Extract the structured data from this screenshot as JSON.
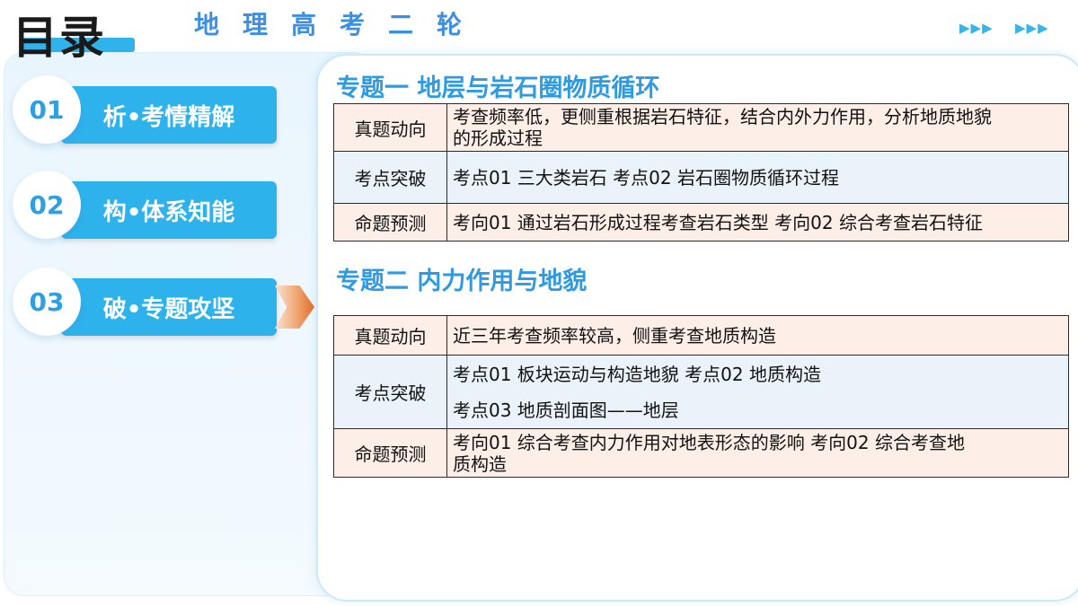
{
  "header": {
    "title": "目录",
    "subject": "地理高考二轮",
    "arrows_left": "▶▶▶",
    "arrows_right": "▶▶▶"
  },
  "menu": [
    {
      "number": "01",
      "label": "析•考情精解"
    },
    {
      "number": "02",
      "label": "构•体系知能"
    },
    {
      "number": "03",
      "label": "破•专题攻坚"
    }
  ],
  "topics": [
    {
      "title": "专题一  地层与岩石圈物质循环",
      "rows": [
        {
          "head": "真题动向",
          "lines": [
            "考查频率低，更侧重根据岩石特征，结合内外力作用，分析地质地貌",
            "的形成过程"
          ]
        },
        {
          "head": "考点突破",
          "lines": [
            "考点01  三大类岩石     考点02  岩石圈物质循环过程"
          ]
        },
        {
          "head": "命题预测",
          "lines": [
            "考向01  通过岩石形成过程考查岩石类型  考向02  综合考查岩石特征"
          ]
        }
      ]
    },
    {
      "title": "专题二  内力作用与地貌",
      "rows": [
        {
          "head": "真题动向",
          "lines": [
            "近三年考查频率较高，侧重考查地质构造"
          ]
        },
        {
          "head": "考点突破",
          "lines": [
            "考点01  板块运动与构造地貌    考点02  地质构造",
            "考点03  地质剖面图——地层"
          ]
        },
        {
          "head": "命题预测",
          "lines": [
            "考向01  综合考查内力作用对地表形态的影响    考向02  综合考查地",
            "质构造"
          ]
        }
      ]
    }
  ],
  "colors": {
    "accent": "#2eb2ec",
    "topic_title": "#2e9ae2",
    "row_peach": "#fdefe7",
    "row_blue": "#eaf2fa",
    "pointer": "#e06b2a"
  },
  "icons": {
    "pointer": "chevron-right-icon",
    "arrows": "triple-arrow-icon"
  }
}
